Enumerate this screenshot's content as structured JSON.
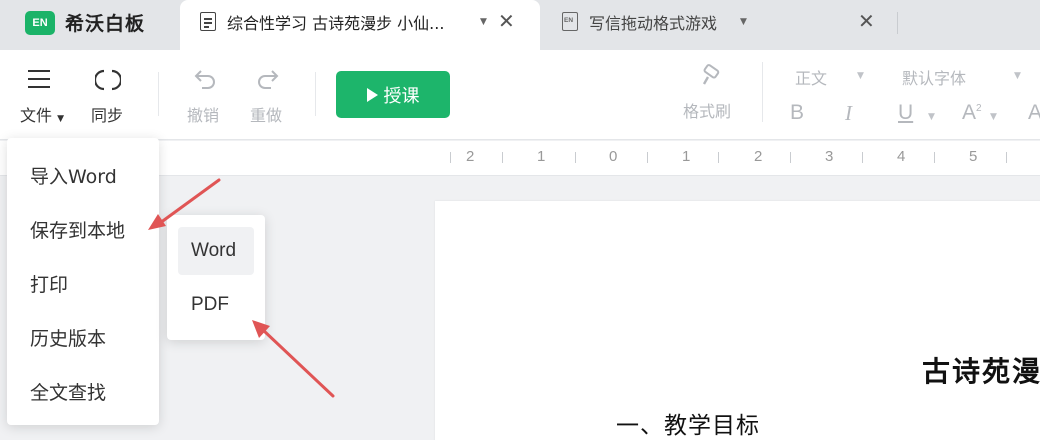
{
  "app": {
    "logo_badge": "EN",
    "name": "希沃白板"
  },
  "tabs": [
    {
      "title": "综合性学习 古诗苑漫步 小仙...",
      "active": true
    },
    {
      "title": "写信拖动格式游戏",
      "active": false
    }
  ],
  "toolbar": {
    "file_label": "文件",
    "sync_label": "同步",
    "undo_label": "撤销",
    "redo_label": "重做",
    "teach_label": "授课",
    "format_painter_label": "格式刷",
    "paragraph_style": "正文",
    "font_family": "默认字体"
  },
  "ruler": {
    "numbers": [
      "2",
      "1",
      "0",
      "1",
      "2",
      "3",
      "4",
      "5"
    ]
  },
  "file_menu": {
    "items": [
      "导入Word",
      "保存到本地",
      "打印",
      "历史版本",
      "全文查找"
    ],
    "save_submenu": [
      "Word",
      "PDF"
    ]
  },
  "document": {
    "title_visible": "古诗苑漫",
    "heading": "一、教学目标"
  },
  "colors": {
    "accent": "#1db56b",
    "annotation_arrow": "#e05555",
    "tab_bar": "#e3e5e8"
  },
  "icons": [
    "hamburger-icon",
    "sync-icon",
    "undo-icon",
    "redo-icon",
    "play-icon",
    "format-painter-icon",
    "bold-icon",
    "italic-icon",
    "underline-icon",
    "superscript-icon",
    "font-color-icon",
    "doc-icon",
    "close-icon",
    "chevron-down-icon"
  ]
}
